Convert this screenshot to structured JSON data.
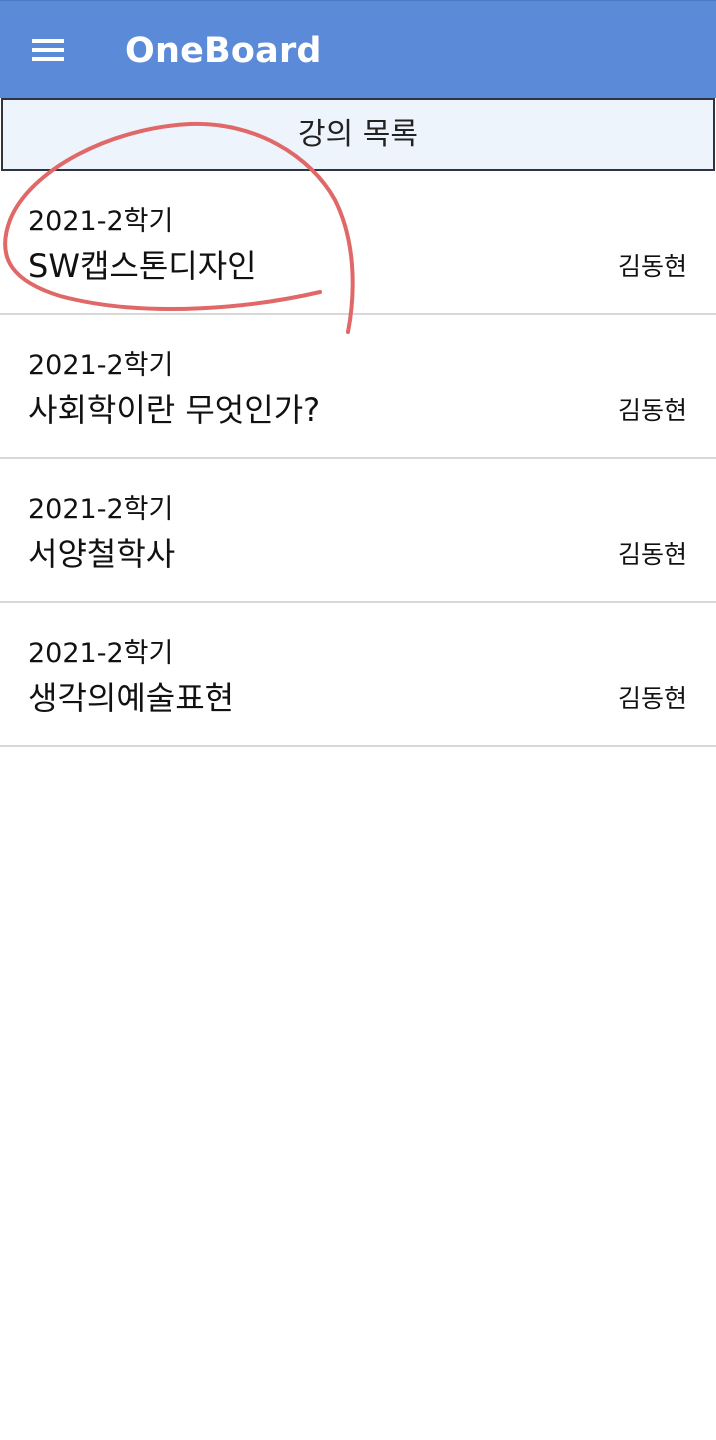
{
  "app_bar": {
    "title": "OneBoard",
    "menu_icon": "hamburger-menu-icon",
    "background_color": "#5b8ad8"
  },
  "section": {
    "title": "강의 목록"
  },
  "courses": [
    {
      "term": "2021-2학기",
      "name": "SW캡스톤디자인",
      "professor": "김동현"
    },
    {
      "term": "2021-2학기",
      "name": "사회학이란 무엇인가?",
      "professor": "김동현"
    },
    {
      "term": "2021-2학기",
      "name": "서양철학사",
      "professor": "김동현"
    },
    {
      "term": "2021-2학기",
      "name": "생각의예술표현",
      "professor": "김동현"
    }
  ],
  "annotation": {
    "color": "#e06868"
  }
}
